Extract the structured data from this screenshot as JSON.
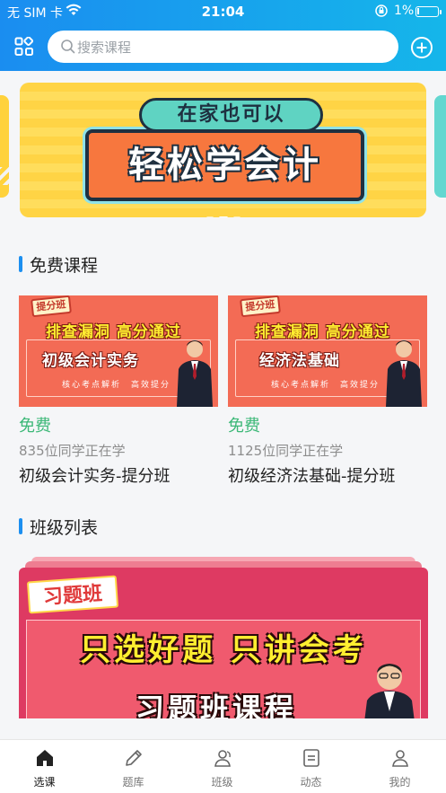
{
  "status_bar": {
    "carrier": "无 SIM 卡",
    "time": "21:04",
    "battery": "1%"
  },
  "header": {
    "search_placeholder": "搜索课程",
    "left_icon": "grid-icon",
    "right_icon": "plus-circle-icon",
    "gradient_colors": [
      "#1a8df0",
      "#15b6ea"
    ]
  },
  "banner": {
    "subtitle": "在家也可以",
    "title": "轻松学会计",
    "slide_count": 3,
    "active_slide": 2
  },
  "free_courses": {
    "title": "免费课程",
    "items": [
      {
        "thumb_tag": "提分班",
        "thumb_slogan": "排查漏洞 高分通过",
        "thumb_subject": "初级会计实务",
        "thumb_small": "核心考点解析　高效提分",
        "price": "免费",
        "learners": "835位同学正在学",
        "name": "初级会计实务-提分班"
      },
      {
        "thumb_tag": "提分班",
        "thumb_slogan": "排查漏洞 高分通过",
        "thumb_subject": "经济法基础",
        "thumb_small": "核心考点解析　高效提分",
        "price": "免费",
        "learners": "1125位同学正在学",
        "name": "初级经济法基础-提分班"
      }
    ]
  },
  "class_list": {
    "title": "班级列表",
    "card": {
      "tag": "习题班",
      "slogan": "只选好题 只讲会考",
      "title": "习题班课程"
    }
  },
  "tabbar": {
    "items": [
      {
        "label": "选课",
        "icon": "home-icon",
        "active": true
      },
      {
        "label": "题库",
        "icon": "pencil-icon",
        "active": false
      },
      {
        "label": "班级",
        "icon": "group-icon",
        "active": false
      },
      {
        "label": "动态",
        "icon": "document-icon",
        "active": false
      },
      {
        "label": "我的",
        "icon": "user-icon",
        "active": false
      }
    ]
  },
  "colors": {
    "accent_blue": "#1c8ff0",
    "free_green": "#3cb877"
  }
}
